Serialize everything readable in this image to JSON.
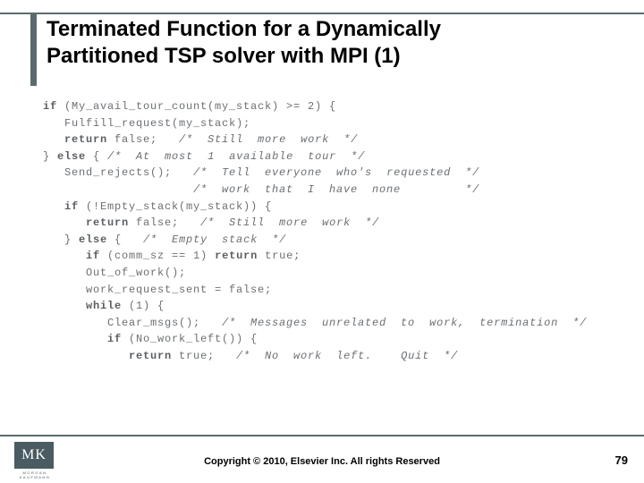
{
  "title": {
    "line1": "Terminated Function for a Dynamically",
    "line2": "Partitioned TSP solver with MPI (1)"
  },
  "code": {
    "l1a": "if",
    "l1b": " (My_avail_tour_count(my_stack) >= 2) {",
    "l2": "   Fulfill_request(my_stack);",
    "l3a": "   ",
    "l3b": "return",
    "l3c": " false;   ",
    "l3d": "/*  Still  more  work  */",
    "l4a": "} ",
    "l4b": "else",
    "l4c": " { ",
    "l4d": "/*  At  most  1  available  tour  */",
    "l5a": "   Send_rejects();   ",
    "l5b": "/*  Tell  everyone  who's  requested  */",
    "l6": "                     /*  work  that  I  have  none         */",
    "l7a": "   ",
    "l7b": "if",
    "l7c": " (!Empty_stack(my_stack)) {",
    "l8a": "      ",
    "l8b": "return",
    "l8c": " false;   ",
    "l8d": "/*  Still  more  work  */",
    "l9a": "   } ",
    "l9b": "else",
    "l9c": " {   ",
    "l9d": "/*  Empty  stack  */",
    "l10a": "      ",
    "l10b": "if",
    "l10c": " (comm_sz == 1) ",
    "l10d": "return",
    "l10e": " true;",
    "l11": "      Out_of_work();",
    "l12": "      work_request_sent = false;",
    "l13a": "      ",
    "l13b": "while",
    "l13c": " (1) {",
    "l14a": "         Clear_msgs();   ",
    "l14b": "/*  Messages  unrelated  to  work,  termination  */",
    "l15a": "         ",
    "l15b": "if",
    "l15c": " (No_work_left()) {",
    "l16a": "            ",
    "l16b": "return",
    "l16c": " true;   ",
    "l16d": "/*  No  work  left.    Quit  */"
  },
  "footer": {
    "logo_text": "MK",
    "logo_sub": "MORGAN KAUFMANN",
    "copyright": "Copyright © 2010, Elsevier Inc. All rights Reserved",
    "page": "79"
  }
}
